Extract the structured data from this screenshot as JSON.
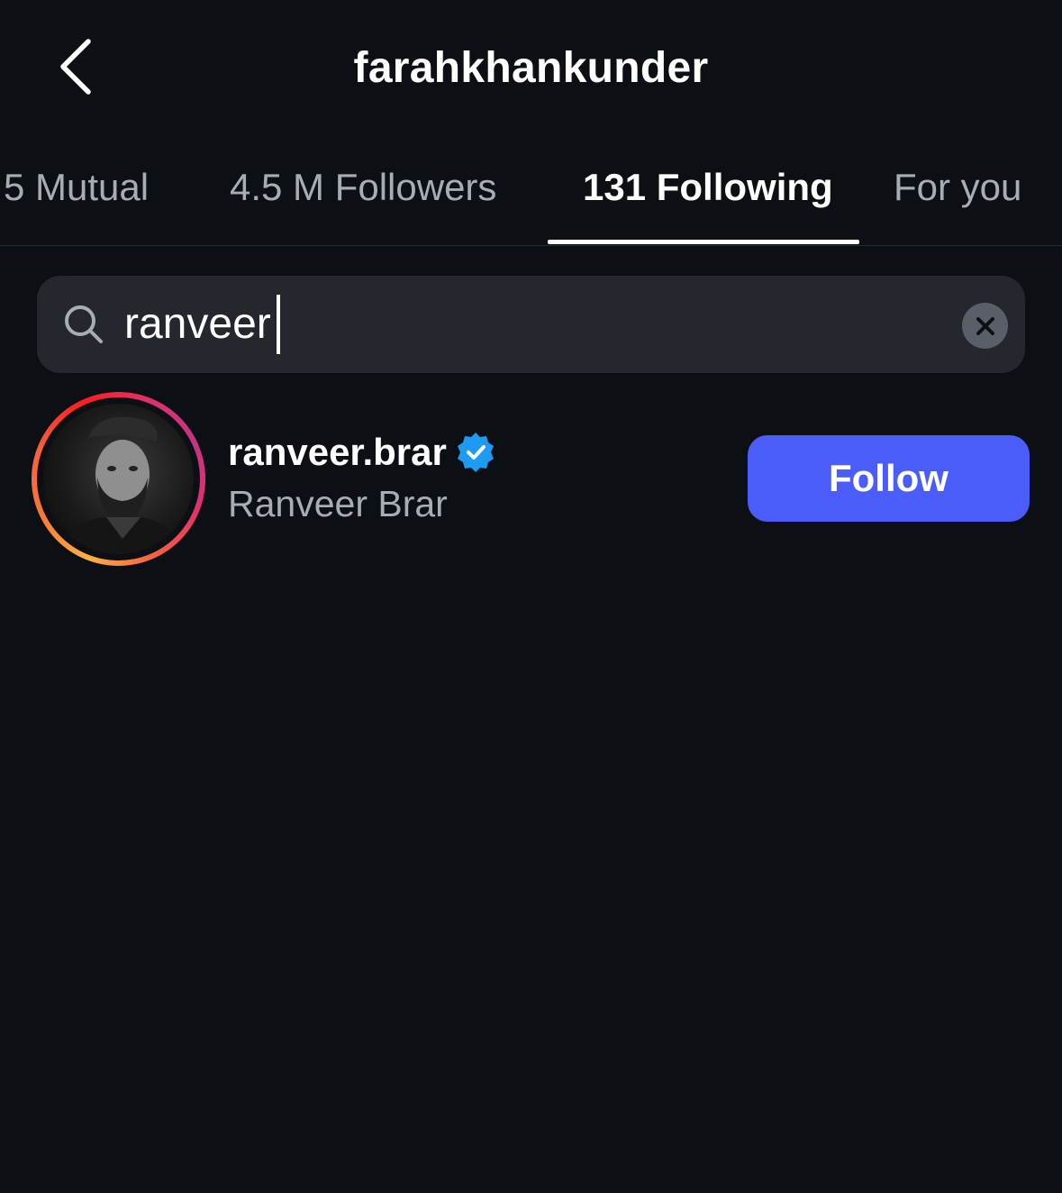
{
  "header": {
    "title": "farahkhankunder",
    "back_icon": "chevron-left-icon"
  },
  "tabs": [
    {
      "label": "5 Mutual",
      "active": false
    },
    {
      "label": "4.5 M Followers",
      "active": false
    },
    {
      "label": "131 Following",
      "active": true
    },
    {
      "label": "For you",
      "active": false
    }
  ],
  "search": {
    "value": "ranveer",
    "icon": "search-icon",
    "clear_icon": "close-circle-icon"
  },
  "results": [
    {
      "username": "ranveer.brar",
      "full_name": "Ranveer Brar",
      "verified": true,
      "follow_label": "Follow"
    }
  ],
  "colors": {
    "background": "#0c0f14",
    "search_bg": "#24272d",
    "follow_button": "#4a5df9",
    "verified_badge": "#1d9bf0",
    "muted_text": "#a8adb5"
  }
}
